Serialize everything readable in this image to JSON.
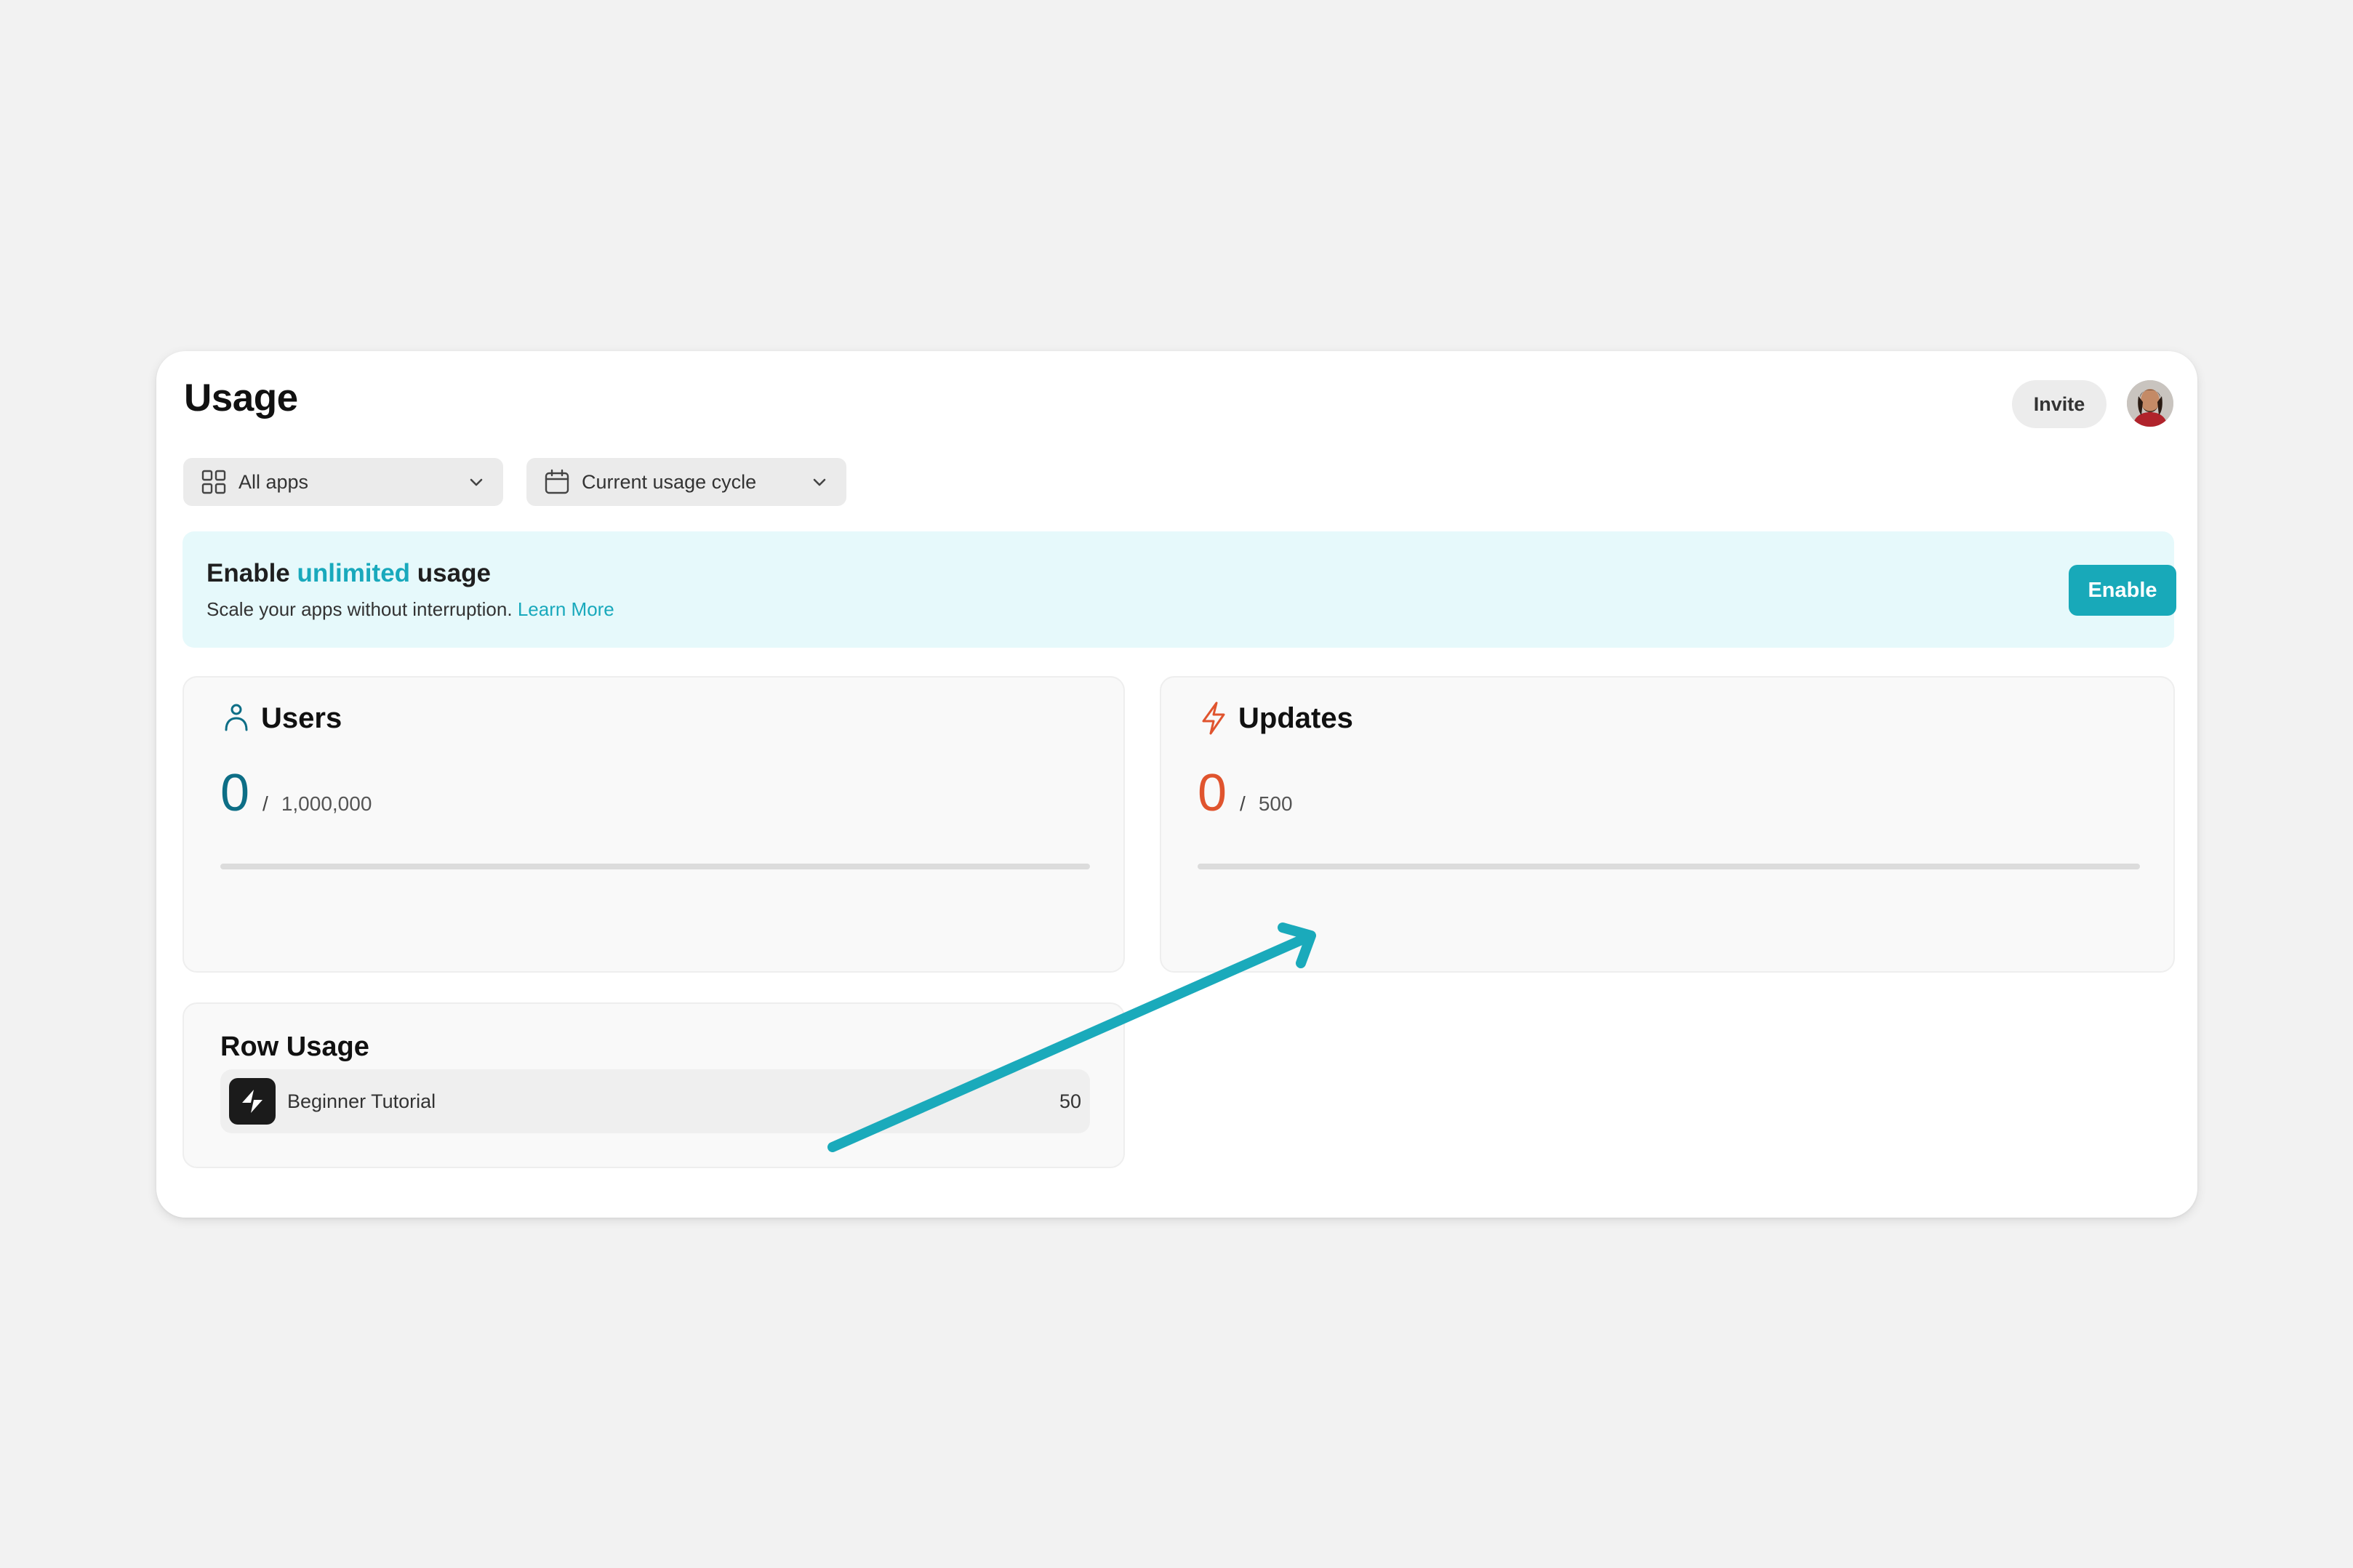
{
  "header": {
    "title": "Usage",
    "invite_label": "Invite"
  },
  "filters": {
    "apps": {
      "icon": "grid-icon",
      "value": "All apps"
    },
    "cycle": {
      "icon": "calendar-icon",
      "value": "Current usage cycle"
    }
  },
  "banner": {
    "title_prefix": "Enable ",
    "title_accent": "unlimited",
    "title_suffix": " usage",
    "subtitle": "Scale your apps without interruption.",
    "link": "Learn More",
    "button": "Enable"
  },
  "users": {
    "icon": "user-icon",
    "title": "Users",
    "value": "0",
    "separator": "/",
    "limit": "1,000,000",
    "progress_fraction": 0
  },
  "updates": {
    "icon": "bolt-icon",
    "title": "Updates",
    "value": "0",
    "separator": "/",
    "limit": "500",
    "progress_fraction": 0
  },
  "row_usage": {
    "title": "Row Usage",
    "items": [
      {
        "icon": "app-logo-icon",
        "name": "Beginner Tutorial",
        "count": "50"
      }
    ]
  },
  "colors": {
    "accent": "#18a9b9",
    "users_value": "#0d6e86",
    "updates_value": "#e0542e",
    "banner_bg": "#e6f9fb",
    "page_bg": "#f2f2f2"
  }
}
